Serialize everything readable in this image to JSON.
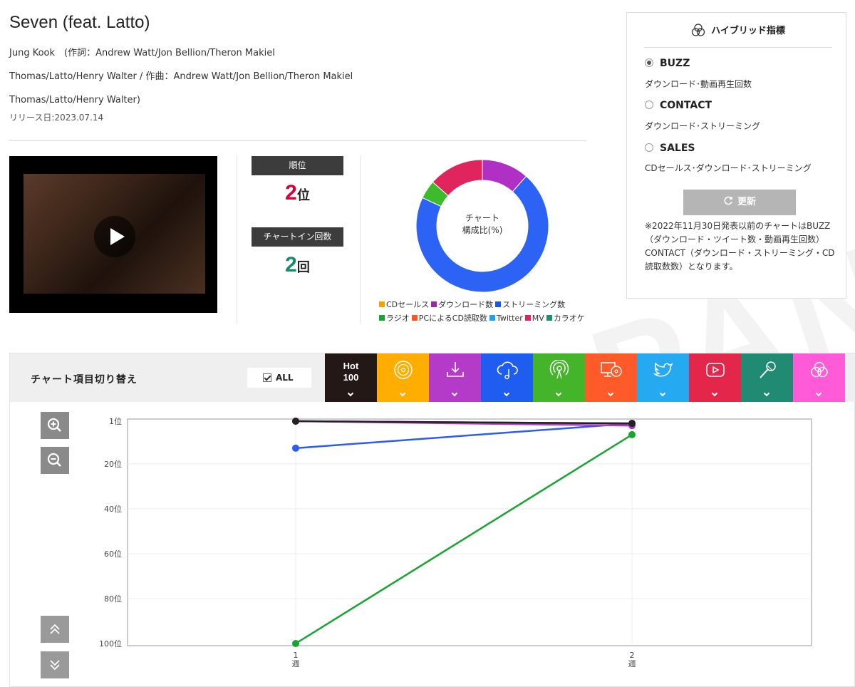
{
  "song": {
    "title": "Seven (feat. Latto)",
    "credit_lines": [
      "Jung Kook　(作詞：Andrew Watt/Jon Bellion/Theron Makiel",
      "Thomas/Latto/Henry Walter / 作曲：Andrew Watt/Jon Bellion/Theron Makiel",
      "Thomas/Latto/Henry Walter)"
    ],
    "release": "リリース日:2023.07.14"
  },
  "stats": {
    "rank_label": "順位",
    "rank_value": "2",
    "rank_unit": "位",
    "chartin_label": "チャートイン回数",
    "chartin_value": "2",
    "chartin_unit": "回",
    "rank_color": "#d6003a",
    "chartin_color": "#1a8a6e"
  },
  "composition": {
    "center_line1": "チャート",
    "center_line2": "構成比(%)",
    "segments": [
      {
        "name": "ダウンロード数",
        "value": 11.5,
        "color": "#b02fc4"
      },
      {
        "name": "ストリーミング数",
        "value": 70.5,
        "color": "#2d63f5"
      },
      {
        "name": "ラジオ",
        "value": 4.5,
        "color": "#3dbb2b"
      },
      {
        "name": "MV",
        "value": 13.5,
        "color": "#e0245e"
      }
    ],
    "legend": [
      {
        "label": "CDセールス",
        "color": "#f5a300"
      },
      {
        "label": "ダウンロード数",
        "color": "#9c27b0"
      },
      {
        "label": "ストリーミング数",
        "color": "#1a56f0"
      },
      {
        "label": "ラジオ",
        "color": "#1aa533"
      },
      {
        "label": "PCによるCD読取数",
        "color": "#ff5722"
      },
      {
        "label": "Twitter",
        "color": "#1da1f2"
      },
      {
        "label": "MV",
        "color": "#e0245e"
      },
      {
        "label": "カラオケ",
        "color": "#1f8f72"
      }
    ]
  },
  "hybrid": {
    "title": "ハイブリッド指標",
    "options": [
      {
        "label": "BUZZ",
        "desc": "ダウンロード･動画再生回数",
        "selected": true
      },
      {
        "label": "CONTACT",
        "desc": "ダウンロード･ストリーミング",
        "selected": false
      },
      {
        "label": "SALES",
        "desc": "CDセールス･ダウンロード･ストリーミング",
        "selected": false
      }
    ],
    "update_label": "更新",
    "note": "※2022年11月30日発表以前のチャートはBUZZ（ダウンロード・ツイート数・動画再生回数）CONTACT（ダウンロード・ストリーミング・CD読取数数）となります。"
  },
  "chart_panel": {
    "switch_label": "チャート項目切り替え",
    "all_label": "ALL",
    "tabs": [
      {
        "name": "hot100",
        "label_line1": "Hot",
        "label_line2": "100",
        "color": "#231816",
        "icon": "none"
      },
      {
        "name": "cd",
        "color": "#ffae00",
        "icon": "cd-icon"
      },
      {
        "name": "download",
        "color": "#b43ac8",
        "icon": "download-icon"
      },
      {
        "name": "streaming",
        "color": "#1f5cf0",
        "icon": "cloud-music-icon"
      },
      {
        "name": "radio",
        "color": "#44b52a",
        "icon": "radio-icon"
      },
      {
        "name": "pc-cd",
        "color": "#ff5a2a",
        "icon": "pc-disc-icon"
      },
      {
        "name": "twitter",
        "color": "#25aaf2",
        "icon": "twitter-icon"
      },
      {
        "name": "mv",
        "color": "#e4264a",
        "icon": "play-icon"
      },
      {
        "name": "karaoke",
        "color": "#208a72",
        "icon": "microphone-icon"
      },
      {
        "name": "hybrid",
        "color": "#ff5ad8",
        "icon": "hybrid-icon"
      }
    ]
  },
  "chart_data": {
    "type": "line",
    "x": [
      1,
      2
    ],
    "x_tick_labels": [
      "1\n週",
      "2\n週"
    ],
    "y_tick_labels": [
      "1位",
      "20位",
      "40位",
      "60位",
      "80位",
      "100位"
    ],
    "y_ticks": [
      1,
      20,
      40,
      60,
      80,
      100
    ],
    "ylim": [
      1,
      100
    ],
    "y_inverted": true,
    "grid": true,
    "series": [
      {
        "values": [
          1,
          2
        ],
        "color": "#222222"
      },
      {
        "values": [
          1,
          3
        ],
        "color": "#b43ac8"
      },
      {
        "values": [
          1,
          2
        ],
        "color": "#e0245e"
      },
      {
        "values": [
          13,
          2
        ],
        "color": "#2d5cf0"
      },
      {
        "values": [
          100,
          7
        ],
        "color": "#1aa533"
      }
    ]
  }
}
